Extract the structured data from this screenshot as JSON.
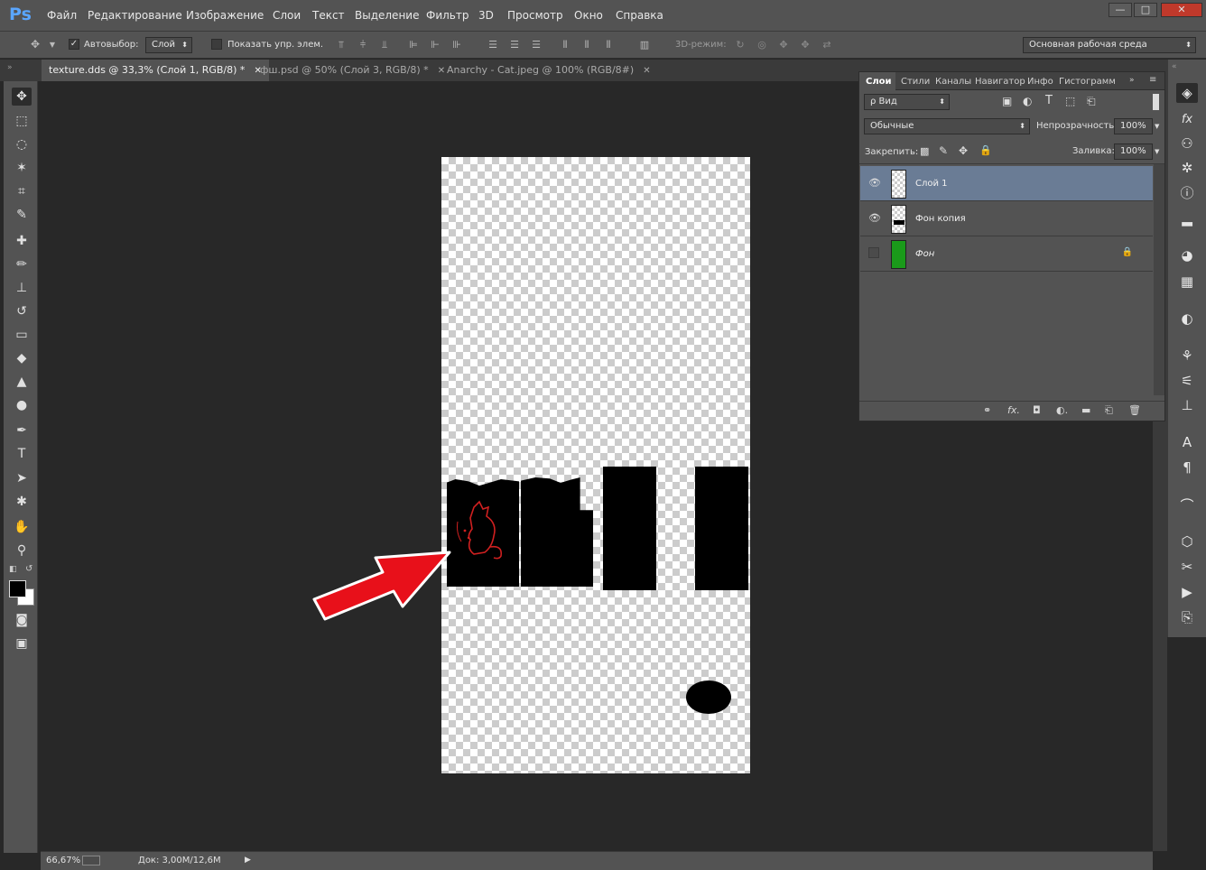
{
  "app": {
    "logo": "Ps"
  },
  "menu": [
    "Файл",
    "Редактирование",
    "Изображение",
    "Слои",
    "Текст",
    "Выделение",
    "Фильтр",
    "3D",
    "Просмотр",
    "Окно",
    "Справка"
  ],
  "window_buttons": {
    "minimize": "—",
    "restore": "□",
    "close": "✕"
  },
  "options": {
    "autoselect_label": "Автовыбор:",
    "autoselect_checked": "✓",
    "autoselect_value": "Слой",
    "show_transform_label": "Показать упр. элем.",
    "mode3d_label": "3D-режим:",
    "workspace": "Основная рабочая среда"
  },
  "tabs": [
    {
      "label": "texture.dds @ 33,3% (Слой 1, RGB/8) *",
      "close": "✕"
    },
    {
      "label": "фш.psd @ 50% (Слой 3, RGB/8) *",
      "close": "✕"
    },
    {
      "label": "Anarchy - Cat.jpeg @ 100% (RGB/8#)",
      "close": "✕"
    }
  ],
  "status": {
    "zoom": "66,67%",
    "doc": "Док: 3,00М/12,6М",
    "arrow": "▶"
  },
  "layers_panel": {
    "tabs": [
      "Слои",
      "Стили",
      "Каналы",
      "Навигатор",
      "Инфо",
      "Гистограмм"
    ],
    "filter": "ρ Вид",
    "blend_mode": "Обычные",
    "opacity_label": "Непрозрачность:",
    "opacity": "100%",
    "lock_label": "Закрепить:",
    "fill_label": "Заливка:",
    "fill": "100%",
    "layers": [
      {
        "name": "Слой 1",
        "visible": "👁"
      },
      {
        "name": "Фон копия",
        "visible": "👁"
      },
      {
        "name": "Фон",
        "lock": "🔒"
      }
    ]
  },
  "colors": {
    "accent": "#5aa6ff",
    "selected_layer": "#6a7c95",
    "arrow": "#e8101a",
    "background_layer": "#1a9a1a"
  }
}
